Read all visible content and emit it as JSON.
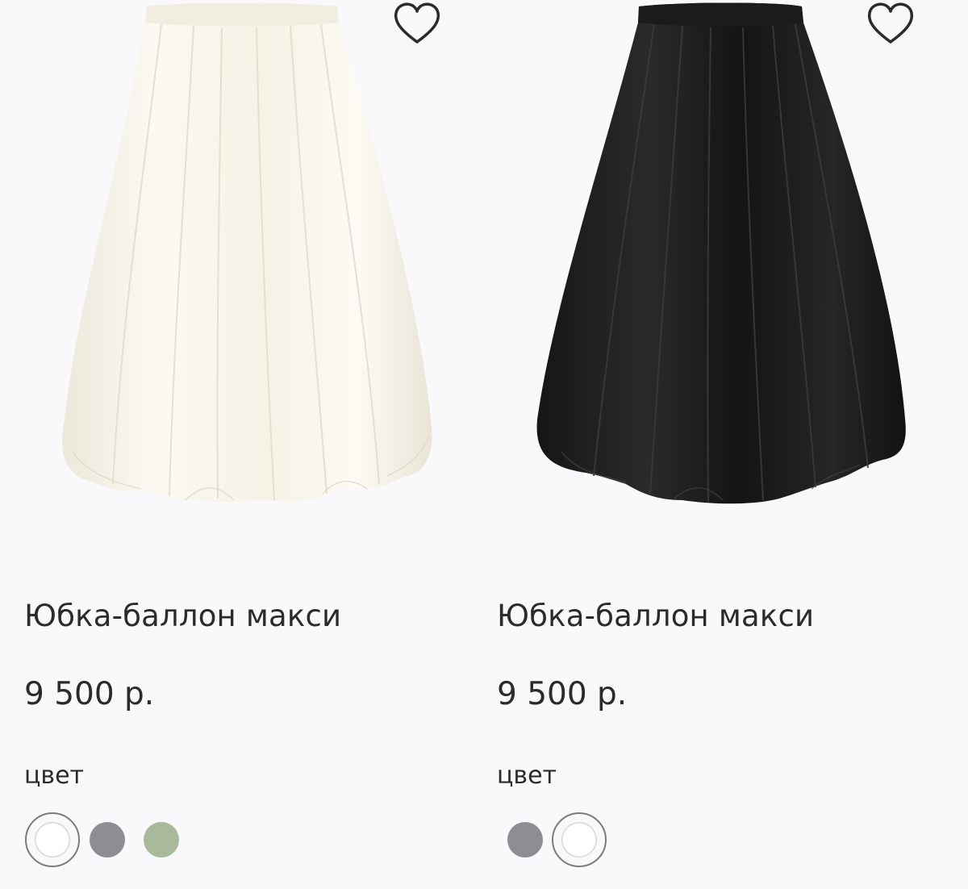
{
  "products": [
    {
      "title": "Юбка-баллон макси",
      "price": "9 500 р.",
      "color_label": "цвет",
      "image_color": "#f7f4ea",
      "favorite_icon": "heart-outline-icon",
      "swatches": [
        {
          "color": "#ffffff",
          "selected": true
        },
        {
          "color": "#8e8d92",
          "selected": false
        },
        {
          "color": "#a9b99b",
          "selected": false
        }
      ]
    },
    {
      "title": "Юбка-баллон макси",
      "price": "9 500 р.",
      "color_label": "цвет",
      "image_color": "#111111",
      "favorite_icon": "heart-outline-icon",
      "swatches": [
        {
          "color": "#8e8d92",
          "selected": false
        },
        {
          "color": "#ffffff",
          "selected": true
        }
      ]
    }
  ]
}
